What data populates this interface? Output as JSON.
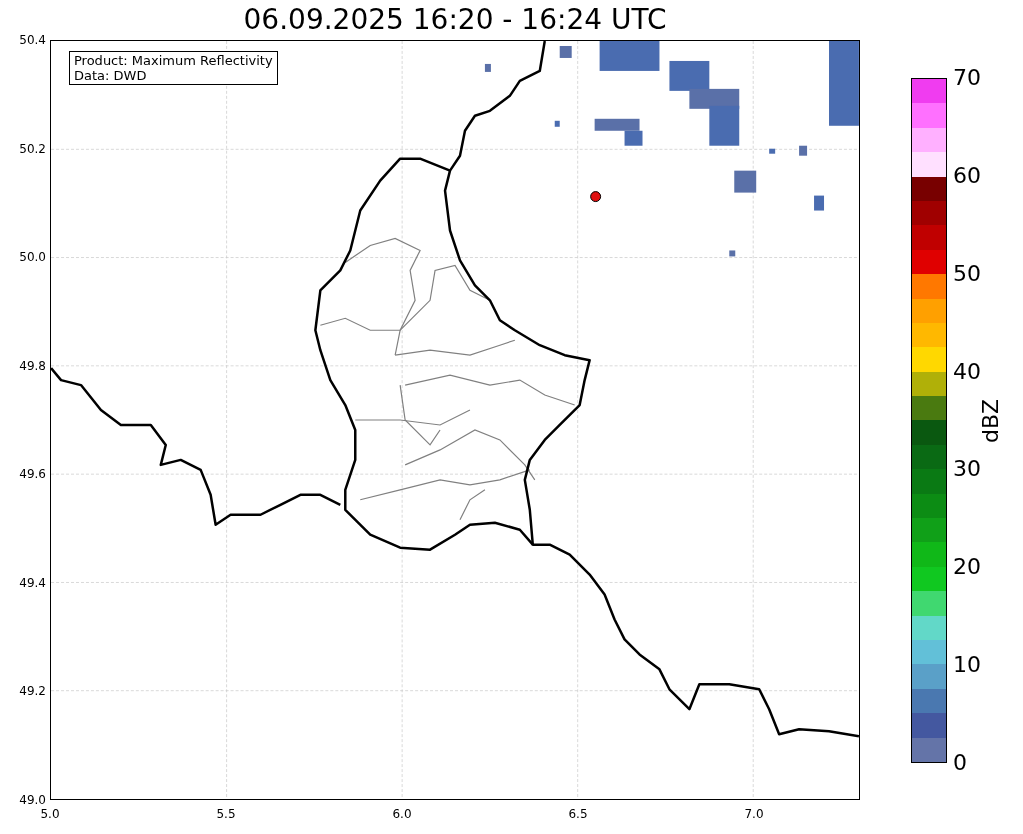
{
  "title": "06.09.2025 16:20 - 16:24 UTC",
  "info_box": {
    "lines": [
      "Product: Maximum Reflectivity",
      "Data: DWD"
    ]
  },
  "y_ticks": [
    "50.4",
    "50.2",
    "50.0",
    "49.8",
    "49.6",
    "49.4",
    "49.2",
    "49.0"
  ],
  "x_ticks": [
    "5.0",
    "5.5",
    "6.0",
    "6.5",
    "7.0"
  ],
  "colorbar": {
    "label": "dBZ",
    "ticks": [
      "70",
      "60",
      "50",
      "40",
      "30",
      "20",
      "10",
      "0"
    ],
    "bands": [
      {
        "color": "#f03cf0"
      },
      {
        "color": "#ff70ff"
      },
      {
        "color": "#ffb0ff"
      },
      {
        "color": "#ffe0ff"
      },
      {
        "color": "#780000"
      },
      {
        "color": "#a00000"
      },
      {
        "color": "#c00000"
      },
      {
        "color": "#e00000"
      },
      {
        "color": "#ff7800"
      },
      {
        "color": "#ffa000"
      },
      {
        "color": "#ffb800"
      },
      {
        "color": "#ffd800"
      },
      {
        "color": "#b0b008"
      },
      {
        "color": "#4a7a10"
      },
      {
        "color": "#0a5810"
      },
      {
        "color": "#0a6a14"
      },
      {
        "color": "#0a7a14"
      },
      {
        "color": "#0c8c14"
      },
      {
        "color": "#10a018"
      },
      {
        "color": "#10b818"
      },
      {
        "color": "#10c820"
      },
      {
        "color": "#40d870"
      },
      {
        "color": "#62d8c8"
      },
      {
        "color": "#62c0d8"
      },
      {
        "color": "#5aa0c8"
      },
      {
        "color": "#4a78b0"
      },
      {
        "color": "#4458a0"
      },
      {
        "color": "#6474a8"
      }
    ]
  }
}
